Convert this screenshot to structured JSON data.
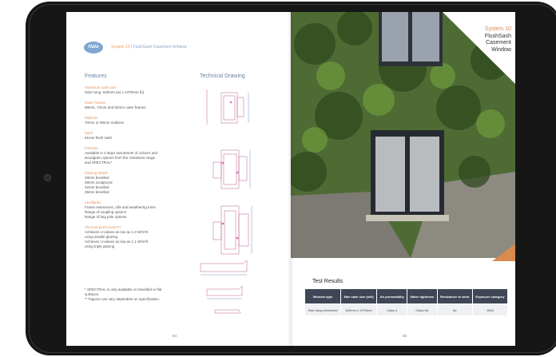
{
  "brochure": {
    "logo_text": "Halo",
    "breadcrumb_system": "System 10",
    "breadcrumb_rest": " | FlushSash Casement Window",
    "features_heading": "Features",
    "technical_heading": "Technical Drawing",
    "features": [
      {
        "title": "Maximum sash size",
        "body": "Side hung: 620mm (w) x 1370mm (h)"
      },
      {
        "title": "Outer frames",
        "body": "58mm, 72mm and 84mm outer frames"
      },
      {
        "title": "Mullions",
        "body": "70mm or 95mm mullions"
      },
      {
        "title": "Sash",
        "body": "61mm flush sash"
      },
      {
        "title": "Finishes",
        "body": "Available in a large assortment of colours and\nwoodgrain options from the Variations range\nand SPECTRAL*"
      },
      {
        "title": "Glazing beads",
        "body": "28mm bevelled\n28mm sculptured\n32mm bevelled\n36mm bevelled"
      },
      {
        "title": "Ancillaries",
        "body": "Frame extensions, cills and weathering trims\nRange of coupling options\nRange of bay pole options"
      },
      {
        "title": "Thermal performance**",
        "body": "Achieves U-values as low as 1.3 W/m²K\nusing double glazing\nAchieves U-values as low as 1.1 W/m²K\nusing triple glazing"
      }
    ],
    "footnote": "* SPECTRAL is only available on bevelled or flat\n  surfaces.\n** Figures can vary dependent on specification.",
    "page_left": "54",
    "page_right": "55",
    "title_line1": "System 10",
    "title_line2": "FlushSash",
    "title_line3": "Casement",
    "title_line4": "Window",
    "test_heading": "Test Results",
    "table": {
      "headers": [
        "Window type",
        "Max sash size (w/h)",
        "Air permeability",
        "Water tightness",
        "Resistance to wind",
        "Exposure category"
      ],
      "rows": [
        [
          "Side hung reinforced",
          "620mm x 1370mm",
          "Class 4",
          "Class 9A",
          "A4",
          "1600"
        ]
      ]
    }
  },
  "colors": {
    "accent": "#d98a4e",
    "heading_blue": "#6b86a6",
    "table_header": "#3f4756"
  }
}
